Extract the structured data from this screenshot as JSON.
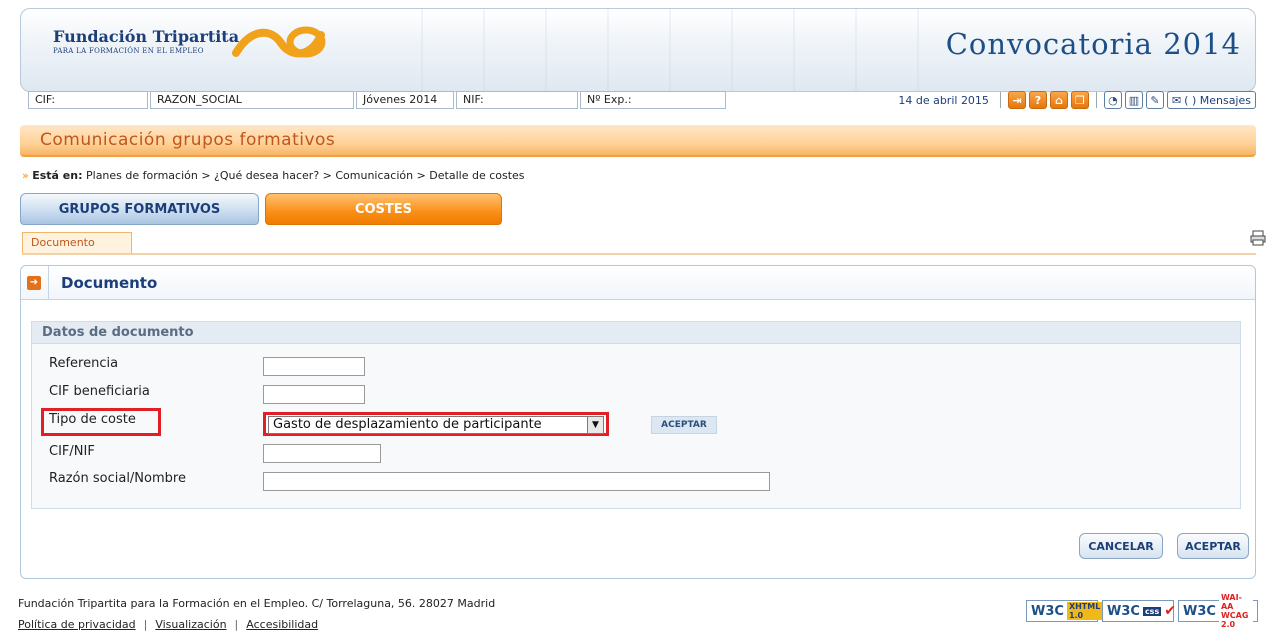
{
  "header": {
    "org_name": "Fundación Tripartita",
    "org_subtitle": "PARA LA FORMACIÓN EN EL EMPLEO",
    "program_title": "Convocatoria 2014"
  },
  "infobar": {
    "cif": "CIF:",
    "razon_social": "RAZON_SOCIAL",
    "jovenes": "Jóvenes 2014",
    "nif": "NIF:",
    "num_exp": "Nº Exp.:",
    "date": "14 de abril 2015",
    "mensajes_label": "(    ) Mensajes"
  },
  "icons": [
    "exit-icon",
    "help-icon",
    "home-icon",
    "copy-icon",
    "chart-icon",
    "bar-chart-icon",
    "edit-icon",
    "mail-icon",
    "print-icon"
  ],
  "section_title": "Comunicación grupos formativos",
  "breadcrumb": {
    "prefix": "Está en:",
    "path": "Planes de formación > ¿Qué desea hacer? > Comunicación > Detalle de costes"
  },
  "tabs": {
    "grupos": "GRUPOS FORMATIVOS",
    "costes": "COSTES"
  },
  "subtab": "Documento",
  "panel": {
    "title": "Documento",
    "group_title": "Datos de documento",
    "fields": {
      "referencia": {
        "label": "Referencia",
        "value": ""
      },
      "cif_beneficiaria": {
        "label": "CIF beneficiaria",
        "value": ""
      },
      "tipo_coste": {
        "label": "Tipo de coste",
        "value": "Gasto de desplazamiento de participante"
      },
      "cif_nif": {
        "label": "CIF/NIF",
        "value": ""
      },
      "razon_social": {
        "label": "Razón social/Nombre",
        "value": ""
      }
    },
    "aceptar_small": "ACEPTAR",
    "cancelar": "CANCELAR",
    "aceptar": "ACEPTAR"
  },
  "footer": {
    "address": "Fundación Tripartita para la Formación en el Empleo. C/ Torrelaguna, 56. 28027 Madrid",
    "links": [
      "Política de privacidad",
      "Visualización",
      "Accesibilidad"
    ]
  },
  "badges": {
    "xhtml": {
      "w": "W3C",
      "tag": "XHTML 1.0"
    },
    "css": {
      "w": "W3C",
      "tag": "css"
    },
    "wai": {
      "w": "W3C",
      "tag": "WAI-AA WCAG 2.0"
    }
  }
}
